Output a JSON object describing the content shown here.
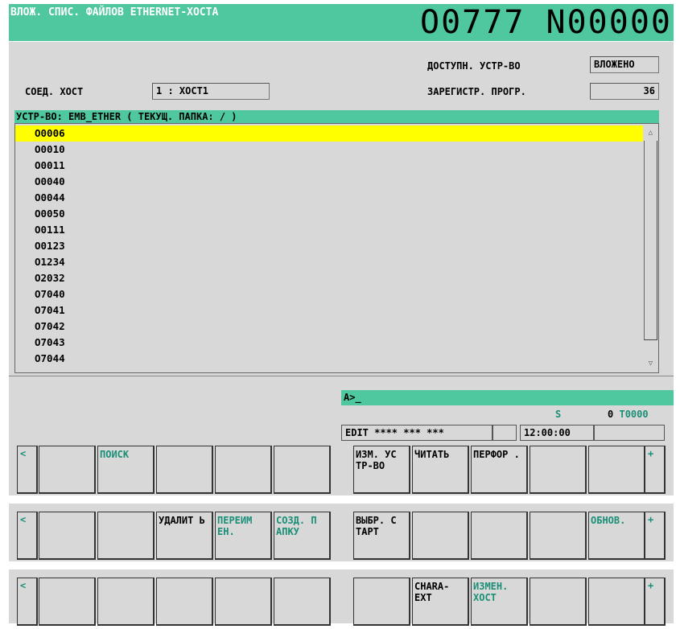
{
  "header": {
    "title": "ВЛОЖ. СПИС. ФАЙЛОВ ETHERNET-ХОСТА",
    "program": "O0777 N00000"
  },
  "info": {
    "available_device_label": "ДОСТУПН. УСТР-ВО",
    "available_device_value": "ВЛОЖЕНО",
    "connected_host_label": "СОЕД. ХОСТ",
    "connected_host_value": "1 : ХОСТ1",
    "registered_programs_label": "ЗАРЕГИСТР. ПРОГР.",
    "registered_programs_value": "36"
  },
  "list": {
    "header": "УСТР-ВО: EMB_ETHER  ( ТЕКУЩ. ПАПКА: / )",
    "items": [
      "O0006",
      "O0010",
      "O0011",
      "O0040",
      "O0044",
      "O0050",
      "O0111",
      "O0123",
      "O1234",
      "O2032",
      "O7040",
      "O7041",
      "O7042",
      "O7043",
      "O7044"
    ],
    "selected_index": 0,
    "scroll_up": "△",
    "scroll_down": "▽"
  },
  "keyin": "A>_",
  "status": {
    "s_label": "S",
    "s_value": "0",
    "t_value": "T0000",
    "mode": "EDIT **** *** ***",
    "time": "12:00:00"
  },
  "softkeys": {
    "left_arrow": "<",
    "right_arrow": "+",
    "row1": [
      "",
      "ПОИСК",
      "",
      "",
      "",
      "ИЗМ. УС ТР-ВО",
      "ЧИТАТЬ",
      "ПЕРФОР .",
      "",
      ""
    ],
    "row2": [
      "",
      "",
      "УДАЛИТ Ь",
      "ПЕРЕИМ ЕН.",
      "СОЗД. П АПКУ",
      "ВЫБР. С ТАРТ",
      "",
      "",
      "",
      "ОБНОВ."
    ],
    "row3": [
      "",
      "",
      "",
      "",
      "",
      "",
      "CHARA- EXT",
      "ИЗМЕН. ХОСТ",
      "",
      ""
    ]
  },
  "colors": {
    "accent": "#4fc8a0",
    "highlight": "#ffff00",
    "panel": "#d8d8d8",
    "teal_text": "#1a8f77"
  }
}
